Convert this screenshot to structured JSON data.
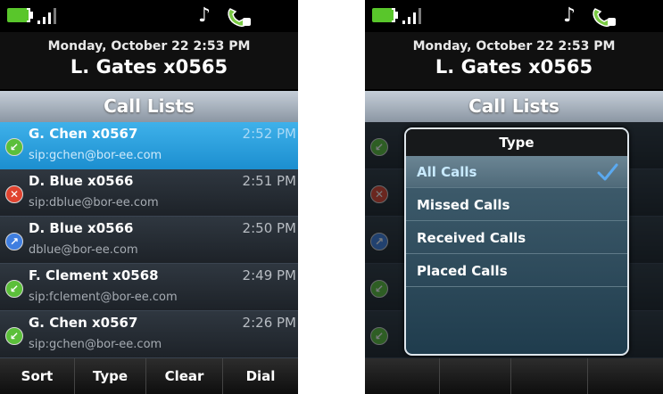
{
  "status": {
    "battery_color": "#59c62b",
    "icons": [
      "battery-icon",
      "signal-icon",
      "music-note-icon",
      "handset-icon"
    ]
  },
  "header": {
    "date": "Monday, October 22 2:53 PM",
    "user": "L. Gates x0565"
  },
  "title": "Call Lists",
  "calls": [
    {
      "type": "received",
      "name": "G. Chen x0567",
      "time": "2:52 PM",
      "address": "sip:gchen@bor-ee.com",
      "selected": true
    },
    {
      "type": "missed",
      "name": "D. Blue x0566",
      "time": "2:51 PM",
      "address": "sip:dblue@bor-ee.com",
      "selected": false
    },
    {
      "type": "placed",
      "name": "D. Blue x0566",
      "time": "2:50 PM",
      "address": "dblue@bor-ee.com",
      "selected": false
    },
    {
      "type": "received",
      "name": "F. Clement x0568",
      "time": "2:49 PM",
      "address": "sip:fclement@bor-ee.com",
      "selected": false
    },
    {
      "type": "received",
      "name": "G. Chen x0567",
      "time": "2:26 PM",
      "address": "sip:gchen@bor-ee.com",
      "selected": false
    }
  ],
  "softkeys": [
    "Sort",
    "Type",
    "Clear",
    "Dial"
  ],
  "type_popup": {
    "title": "Type",
    "options": [
      "All Calls",
      "Missed Calls",
      "Received Calls",
      "Placed Calls"
    ],
    "selected": "All Calls"
  },
  "colors": {
    "selected_row": "#2a9fe0",
    "received_icon": "#5bbf3a",
    "missed_icon": "#e0432f",
    "placed_icon": "#3f7ee0"
  }
}
